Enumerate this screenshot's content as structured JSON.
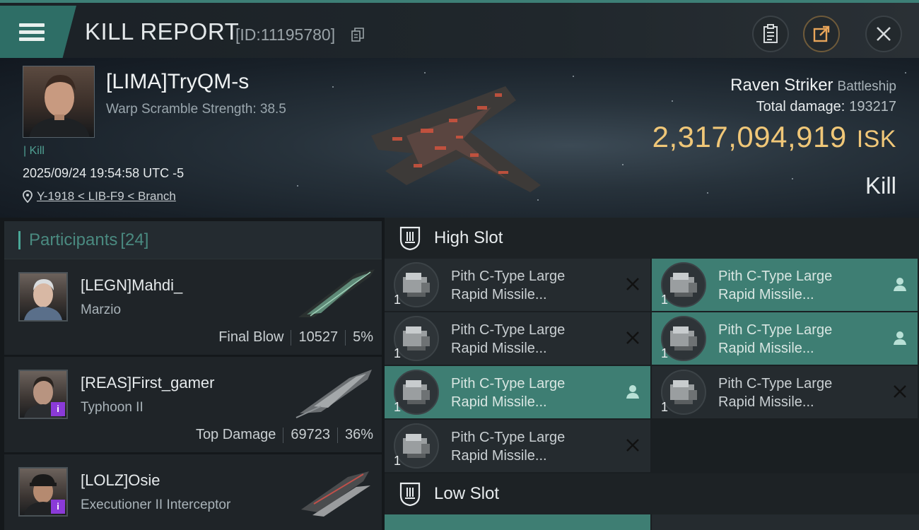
{
  "header": {
    "title": "KILL REPORT",
    "report_id": "[ID:11195780]"
  },
  "victim": {
    "name": "[LIMA]TryQM-s",
    "warp_scramble": "Warp Scramble Strength: 38.5",
    "kill_tag": "| Kill",
    "timestamp": "2025/09/24 19:54:58 UTC -5",
    "location": "Y-1918 < LIB-F9 < Branch",
    "ship_name": "Raven Striker",
    "ship_class": "Battleship",
    "total_damage_label": "Total damage:",
    "total_damage": "193217",
    "isk_value": "2,317,094,919",
    "isk_unit": "ISK",
    "result": "Kill"
  },
  "participants": {
    "label": "Participants",
    "count": "[24]",
    "items": [
      {
        "name": "[LEGN]Mahdi_",
        "ship": "Marzio",
        "role": "Final Blow",
        "damage": "10527",
        "percent": "5%",
        "badge": ""
      },
      {
        "name": "[REAS]First_gamer",
        "ship": "Typhoon II",
        "role": "Top Damage",
        "damage": "69723",
        "percent": "36%",
        "badge": "i"
      },
      {
        "name": "[LOLZ]Osie",
        "ship": "Executioner II Interceptor",
        "role": "",
        "damage": "",
        "percent": "",
        "badge": "i"
      }
    ]
  },
  "high_slot": {
    "label": "High Slot",
    "modules": [
      {
        "name_line1": "Pith C-Type Large",
        "name_line2": "Rapid Missile...",
        "qty": "1",
        "status": "destroyed"
      },
      {
        "name_line1": "Pith C-Type Large",
        "name_line2": "Rapid Missile...",
        "qty": "1",
        "status": "dropped"
      },
      {
        "name_line1": "Pith C-Type Large",
        "name_line2": "Rapid Missile...",
        "qty": "1",
        "status": "destroyed"
      },
      {
        "name_line1": "Pith C-Type Large",
        "name_line2": "Rapid Missile...",
        "qty": "1",
        "status": "dropped"
      },
      {
        "name_line1": "Pith C-Type Large",
        "name_line2": "Rapid Missile...",
        "qty": "1",
        "status": "dropped"
      },
      {
        "name_line1": "Pith C-Type Large",
        "name_line2": "Rapid Missile...",
        "qty": "1",
        "status": "destroyed"
      },
      {
        "name_line1": "Pith C-Type Large",
        "name_line2": "Rapid Missile...",
        "qty": "1",
        "status": "destroyed"
      }
    ]
  },
  "low_slot": {
    "label": "Low Slot"
  },
  "colors": {
    "accent": "#3e7e73",
    "isk": "#f0c778",
    "badge": "#8a3ad8"
  },
  "icons": {
    "menu": "hamburger-icon",
    "copy": "copy-icon",
    "clipboard": "clipboard-icon",
    "share": "share-icon",
    "close": "close-icon",
    "location": "location-pin-icon",
    "slot": "slot-shield-icon",
    "destroyed": "x-icon",
    "dropped": "person-icon"
  }
}
